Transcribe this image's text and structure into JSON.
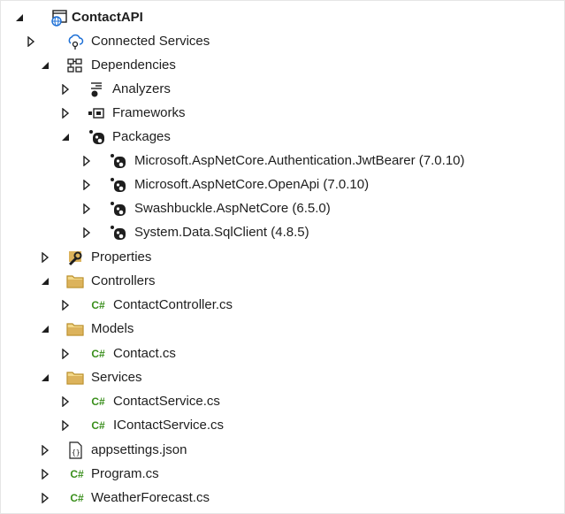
{
  "tree": {
    "project": "ContactAPI",
    "connected_services": "Connected Services",
    "dependencies": "Dependencies",
    "analyzers": "Analyzers",
    "frameworks": "Frameworks",
    "packages": "Packages",
    "package_items": [
      "Microsoft.AspNetCore.Authentication.JwtBearer (7.0.10)",
      "Microsoft.AspNetCore.OpenApi (7.0.10)",
      "Swashbuckle.AspNetCore (6.5.0)",
      "System.Data.SqlClient (4.8.5)"
    ],
    "properties": "Properties",
    "controllers": "Controllers",
    "contact_controller": "ContactController.cs",
    "models": "Models",
    "contact": "Contact.cs",
    "services": "Services",
    "contact_service": "ContactService.cs",
    "icontact_service": "IContactService.cs",
    "appsettings": "appsettings.json",
    "program": "Program.cs",
    "weather": "WeatherForecast.cs",
    "cs_glyph": "C#"
  },
  "colors": {
    "folder": "#dcb35c",
    "csharp": "#3a8f1c",
    "package": "#1e1e1e",
    "arrow": "#1e1e1e"
  }
}
